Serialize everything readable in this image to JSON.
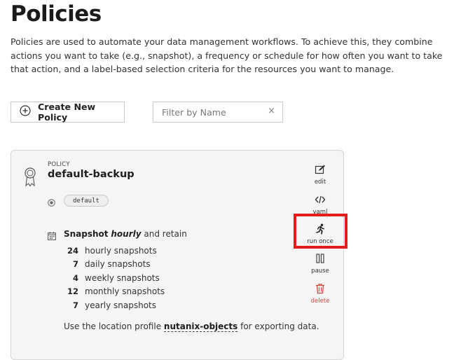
{
  "page": {
    "title": "Policies",
    "description": "Policies are used to automate your data management workflows. To achieve this, they combine actions you want to take (e.g., snapshot), a frequency or schedule for how often you want to take that action, and a label-based selection criteria for the resources you want to manage."
  },
  "toolbar": {
    "create_label": "Create New Policy",
    "filter_placeholder": "Filter by Name",
    "filter_value": "",
    "clear_symbol": "×"
  },
  "policy": {
    "kicker": "POLICY",
    "name": "default-backup",
    "label": "default",
    "snapshot_word": "Snapshot",
    "frequency": "hourly",
    "retain_text": "and retain",
    "retention": [
      {
        "count": "24",
        "text": "hourly snapshots"
      },
      {
        "count": "7",
        "text": "daily snapshots"
      },
      {
        "count": "4",
        "text": "weekly snapshots"
      },
      {
        "count": "12",
        "text": "monthly snapshots"
      },
      {
        "count": "7",
        "text": "yearly snapshots"
      }
    ],
    "export_prefix": "Use the location profile",
    "export_profile": "nutanix-objects",
    "export_suffix": "for exporting data."
  },
  "actions": {
    "edit": "edit",
    "yaml": "yaml",
    "run_once": "run once",
    "pause": "pause",
    "delete": "delete"
  },
  "icons": {
    "create": "plus-circle-icon",
    "policy": "ribbon-icon",
    "label": "target-icon",
    "schedule": "calendar-icon",
    "edit": "edit-icon",
    "yaml": "code-icon",
    "run_once": "running-person-icon",
    "pause": "pause-icon",
    "delete": "trash-icon"
  },
  "colors": {
    "highlight": "#e31c1c",
    "delete": "#d0483a",
    "card_bg": "#f5f5f5"
  }
}
